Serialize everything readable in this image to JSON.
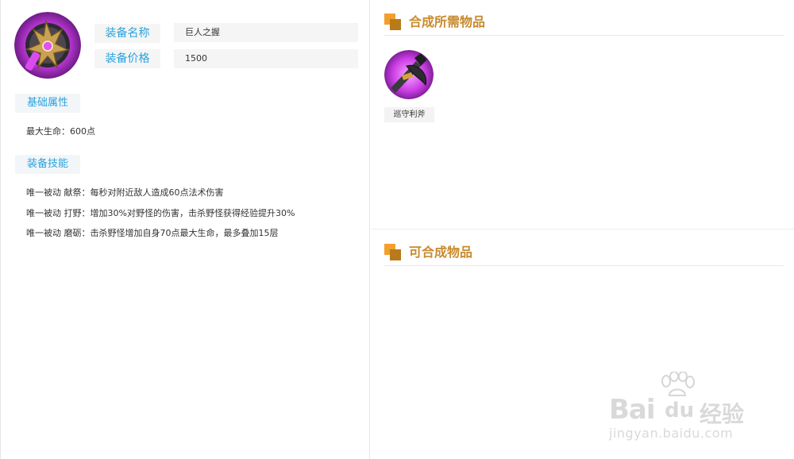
{
  "equipment": {
    "name_label": "装备名称",
    "name_value": "巨人之握",
    "price_label": "装备价格",
    "price_value": "1500",
    "icon": "giant-grip-emblem-icon"
  },
  "basic_attributes": {
    "tab_label": "基础属性",
    "lines": [
      "最大生命：600点"
    ]
  },
  "equipment_skills": {
    "tab_label": "装备技能",
    "lines": [
      "唯一被动 献祭：每秒对附近敌人造成60点法术伤害",
      "唯一被动 打野：增加30%对野怪的伤害，击杀野怪获得经验提升30%",
      "唯一被动 磨砺：击杀野怪增加自身70点最大生命，最多叠加15层"
    ]
  },
  "required_items": {
    "title": "合成所需物品",
    "items": [
      {
        "name": "巡守利斧",
        "icon": "axe-icon"
      }
    ]
  },
  "craftable_items": {
    "title": "可合成物品",
    "items": []
  },
  "watermark": {
    "brand_a": "Bai",
    "brand_b": "du",
    "brand_c": "经验",
    "url": "jingyan.baidu.com"
  },
  "colors": {
    "accent_blue": "#29a3de",
    "accent_gold": "#c88a2e",
    "icon_orange": "#f29f2d"
  }
}
